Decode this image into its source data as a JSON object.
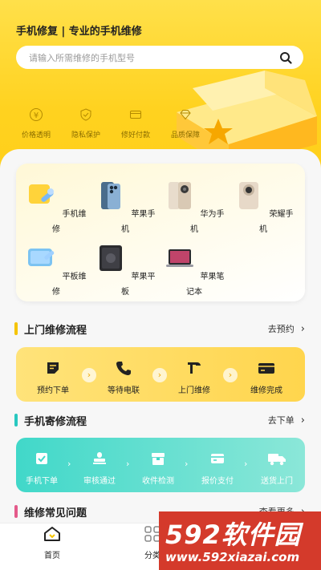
{
  "header": {
    "title": "手机修复 | 专业的手机维修",
    "search_placeholder": "请输入所需维修的手机型号",
    "search_icon": "search-icon",
    "features": [
      {
        "label": "价格透明",
        "icon": "yen-icon"
      },
      {
        "label": "隐私保护",
        "icon": "shield-icon"
      },
      {
        "label": "修好付款",
        "icon": "card-icon"
      },
      {
        "label": "品质保障",
        "icon": "diamond-icon"
      }
    ]
  },
  "categories": [
    {
      "label": "手机维修",
      "icon": "phone-repair-icon"
    },
    {
      "label": "苹果手机",
      "icon": "iphone-icon"
    },
    {
      "label": "华为手机",
      "icon": "huawei-phone-icon"
    },
    {
      "label": "荣耀手机",
      "icon": "honor-phone-icon"
    },
    {
      "label": "平板维修",
      "icon": "tablet-repair-icon"
    },
    {
      "label": "苹果平板",
      "icon": "ipad-icon"
    },
    {
      "label": "苹果笔记本",
      "icon": "macbook-icon"
    }
  ],
  "onsite": {
    "title": "上门维修流程",
    "more": "去预约",
    "accent": "#f5c400",
    "steps": [
      {
        "label": "预约下单",
        "icon": "note-icon"
      },
      {
        "label": "等待电联",
        "icon": "phone-call-icon"
      },
      {
        "label": "上门维修",
        "icon": "hammer-icon"
      },
      {
        "label": "维修完成",
        "icon": "wallet-icon"
      }
    ]
  },
  "mailin": {
    "title": "手机寄修流程",
    "more": "去下单",
    "accent": "#28c8c0",
    "steps": [
      {
        "label": "手机下单",
        "icon": "check-box-icon"
      },
      {
        "label": "审核通过",
        "icon": "stamp-icon"
      },
      {
        "label": "收件检测",
        "icon": "package-icon"
      },
      {
        "label": "报价支付",
        "icon": "pay-card-icon"
      },
      {
        "label": "送货上门",
        "icon": "truck-icon"
      }
    ]
  },
  "faq": {
    "title": "维修常见问题",
    "more": "查看更多",
    "accent": "#e45a8a"
  },
  "tabbar": {
    "home": "首页",
    "category": "分类"
  },
  "watermark": {
    "brand": "592软件园",
    "url": "www.592xiazai.com"
  }
}
